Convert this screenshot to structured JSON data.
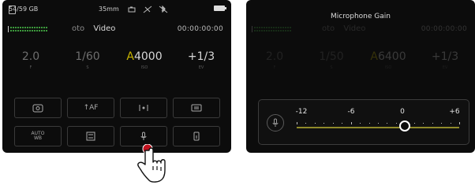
{
  "left_screen": {
    "status": {
      "storage": "54/59 GB",
      "lens": "35mm",
      "icons": [
        "sd-card-icon",
        "stabilizer-icon",
        "no-gps-icon",
        "no-bluetooth-icon",
        "battery-icon"
      ]
    },
    "modes": [
      "oto",
      "Video"
    ],
    "active_mode": "Video",
    "timecode": "00:00:00:00",
    "exposure": [
      {
        "value": "2.0",
        "label": "F"
      },
      {
        "value": "1/60",
        "label": "S"
      },
      {
        "value_prefix": "A",
        "value": "4000",
        "label": "ISO"
      },
      {
        "value": "+1/3",
        "label": "EV"
      }
    ],
    "grid": [
      {
        "text": "",
        "icon": "camera-settings-icon"
      },
      {
        "text": "↑AF",
        "icon": ""
      },
      {
        "text": "",
        "icon": "metering-icon"
      },
      {
        "text": "",
        "icon": "white-balance-icon"
      },
      {
        "text": "AUTO\nWB",
        "icon": ""
      },
      {
        "text": "",
        "icon": "photo-format-icon"
      },
      {
        "text": "",
        "icon": "microphone-icon"
      },
      {
        "text": "",
        "icon": "export-icon"
      }
    ],
    "touch_hint_icon": "tap-hand-icon"
  },
  "right_screen": {
    "title": "Microphone Gain",
    "timecode": "00:00:00:00",
    "modes": [
      "oto",
      "Video"
    ],
    "exposure": [
      {
        "value": "2.0",
        "label": "F"
      },
      {
        "value": "1/50",
        "label": "S"
      },
      {
        "value_prefix": "A",
        "value": "6400",
        "label": "ISO"
      },
      {
        "value": "+1/3",
        "label": "EV"
      }
    ],
    "slider": {
      "labels": [
        "-12",
        "-6",
        "0",
        "+6"
      ],
      "min": -12,
      "max": 6,
      "value": 0,
      "icon": "microphone-icon",
      "accent": "#8f8a2a"
    }
  }
}
